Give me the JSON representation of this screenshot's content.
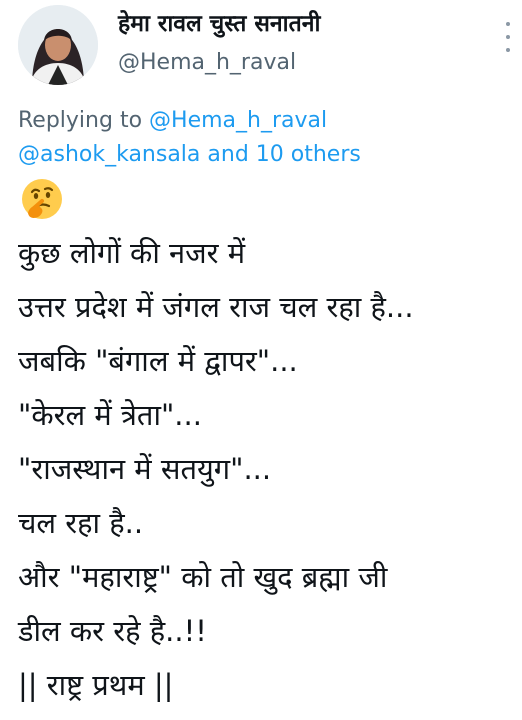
{
  "tweet": {
    "display_name": "हेमा रावल चुस्त सनातनी",
    "handle": "@Hema_h_raval",
    "reply_prefix": "Replying to",
    "reply_to_user": "@Hema_h_raval",
    "reply_to_second": "@ashok_kansala",
    "reply_others": "and 10 others",
    "emoji": "thinking-face",
    "lines": [
      "कुछ लोगों की नजर में",
      "उत्तर प्रदेश में जंगल राज चल रहा है...",
      "जबकि \"बंगाल में द्वापर\"...",
      "\"केरल में त्रेता\"...",
      "\"राजस्थान में सतयुग\"...",
      "चल रहा है..",
      "और \"महाराष्ट्र\" को तो खुद ब्रह्मा जी",
      "डील कर रहे है..!!",
      "|| राष्ट्र प्रथम ||"
    ]
  },
  "colors": {
    "link": "#1d9bf0",
    "muted": "#536471",
    "text": "#0f1419"
  }
}
